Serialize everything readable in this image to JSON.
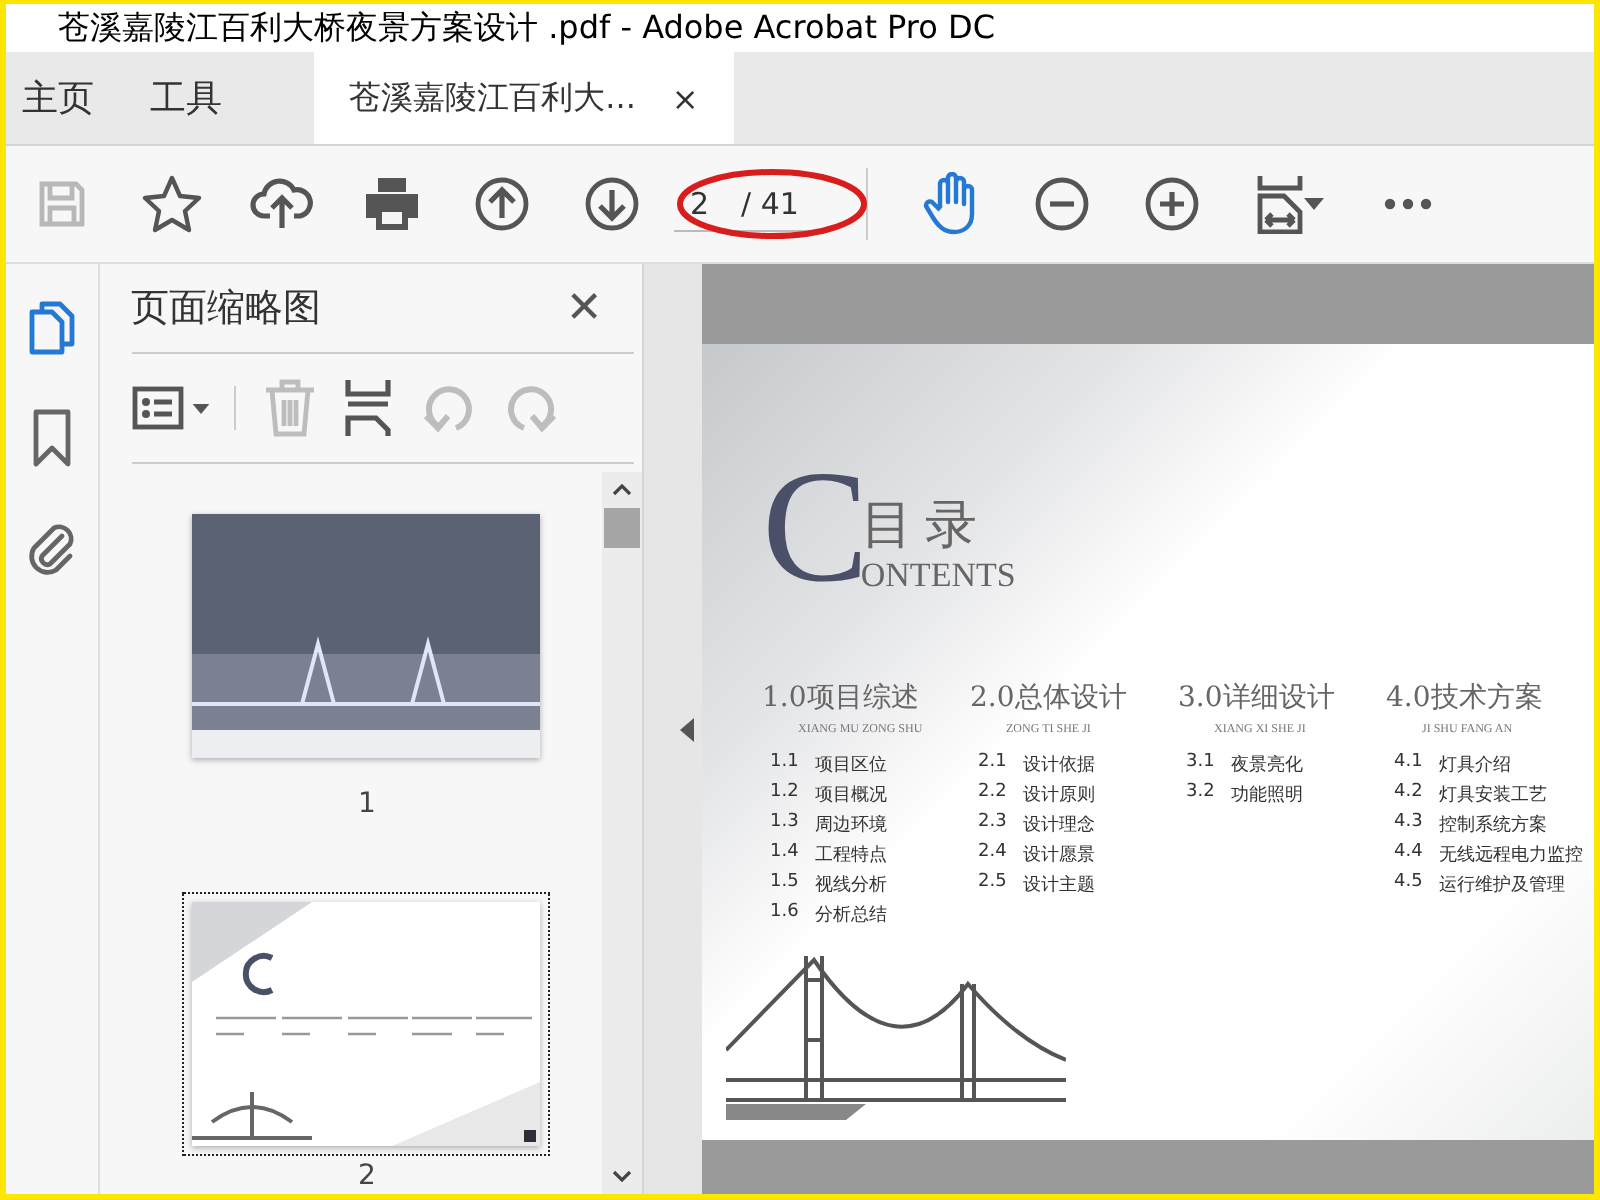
{
  "window": {
    "title": "苍溪嘉陵江百利大桥夜景方案设计 .pdf - Adobe Acrobat Pro DC"
  },
  "tabs": [
    {
      "label": "主页",
      "kind": "nav",
      "selected": false
    },
    {
      "label": "工具",
      "kind": "nav",
      "selected": false
    },
    {
      "label": "苍溪嘉陵江百利大...",
      "kind": "document",
      "selected": true,
      "close": "×"
    }
  ],
  "toolbar": [
    {
      "kind": "save",
      "disabled": true,
      "selected": false
    },
    {
      "kind": "star",
      "disabled": false,
      "selected": false
    },
    {
      "kind": "cloud",
      "disabled": false,
      "selected": false
    },
    {
      "kind": "print",
      "disabled": false,
      "selected": false
    },
    {
      "kind": "up",
      "disabled": false,
      "selected": false
    },
    {
      "kind": "down",
      "disabled": false,
      "selected": false
    },
    {
      "kind": "page",
      "current": "2",
      "total": "/ 41",
      "circled": true
    },
    {
      "kind": "hand",
      "disabled": false,
      "selected": true
    },
    {
      "kind": "zoomout",
      "disabled": false,
      "selected": false
    },
    {
      "kind": "zoomin",
      "disabled": false,
      "selected": false
    },
    {
      "kind": "fit",
      "disabled": false,
      "selected": false
    },
    {
      "kind": "more",
      "disabled": false,
      "selected": false
    }
  ],
  "rail": [
    {
      "kind": "pages",
      "selected": true
    },
    {
      "kind": "bookmark",
      "selected": false
    },
    {
      "kind": "attach",
      "selected": false
    }
  ],
  "panel": {
    "title": "页面缩略图",
    "close": "✕",
    "tools": [
      {
        "kind": "options",
        "disabled": false
      },
      {
        "kind": "delete",
        "disabled": true
      },
      {
        "kind": "extract",
        "disabled": false
      },
      {
        "kind": "undo",
        "disabled": true
      },
      {
        "kind": "redo",
        "disabled": true
      }
    ],
    "thumbnails": [
      {
        "label": "1",
        "kind": "cover",
        "selected": false
      },
      {
        "label": "2",
        "kind": "contents",
        "selected": true
      }
    ]
  },
  "page": {
    "logo_letter": "C",
    "heading": "目录",
    "heading_en": "ONTENTS",
    "sections": [
      {
        "title": "1.0项目综述",
        "pinyin": "XIANG MU ZONG SHU",
        "items": [
          {
            "num": "1.1",
            "text": "项目区位"
          },
          {
            "num": "1.2",
            "text": "项目概况"
          },
          {
            "num": "1.3",
            "text": "周边环境"
          },
          {
            "num": "1.4",
            "text": "工程特点"
          },
          {
            "num": "1.5",
            "text": "视线分析"
          },
          {
            "num": "1.6",
            "text": "分析总结"
          }
        ]
      },
      {
        "title": "2.0总体设计",
        "pinyin": "ZONG TI SHE JI",
        "items": [
          {
            "num": "2.1",
            "text": "设计依据"
          },
          {
            "num": "2.2",
            "text": "设计原则"
          },
          {
            "num": "2.3",
            "text": "设计理念"
          },
          {
            "num": "2.4",
            "text": "设计愿景"
          },
          {
            "num": "2.5",
            "text": "设计主题"
          }
        ]
      },
      {
        "title": "3.0详细设计",
        "pinyin": "XIANG XI SHE JI",
        "items": [
          {
            "num": "3.1",
            "text": "夜景亮化"
          },
          {
            "num": "3.2",
            "text": "功能照明"
          }
        ]
      },
      {
        "title": "4.0技术方案",
        "pinyin": "JI SHU FANG AN",
        "items": [
          {
            "num": "4.1",
            "text": "灯具介绍"
          },
          {
            "num": "4.2",
            "text": "灯具安装工艺"
          },
          {
            "num": "4.3",
            "text": "控制系统方案"
          },
          {
            "num": "4.4",
            "text": "无线远程电力监控"
          },
          {
            "num": "4.5",
            "text": "运行维护及管理"
          }
        ]
      }
    ]
  }
}
